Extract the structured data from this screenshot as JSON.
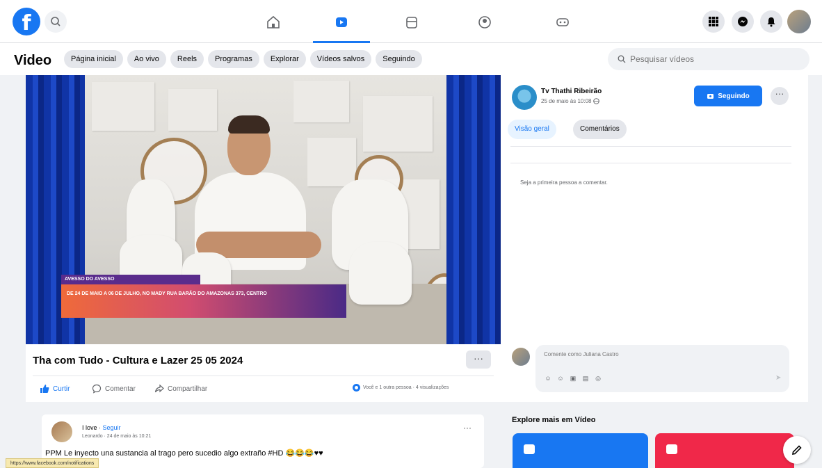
{
  "nav": {
    "logo_letter": "f",
    "tabs": [
      "home-icon",
      "video-icon",
      "marketplace-icon",
      "groups-icon",
      "gaming-icon"
    ],
    "right_icons": [
      "menu-grid-icon",
      "messenger-icon",
      "notifications-icon"
    ],
    "accent": "#1877f2"
  },
  "subheader": {
    "title": "Video",
    "chips": [
      "Página inicial",
      "Ao vivo",
      "Reels",
      "Programas",
      "Explorar",
      "Vídeos salvos",
      "Seguindo"
    ],
    "search_placeholder": "Pesquisar vídeos"
  },
  "video": {
    "banner_top": "AVESSO DO AVESSO",
    "banner_text": "DE 24 DE MAIO A 06 DE JULHO, NO MADY RUA BARÃO DO AMAZONAS 373, CENTRO",
    "title": "Tha com Tudo - Cultura e Lazer 25 05 2024",
    "actions": {
      "like": "Curtir",
      "comment": "Comentar",
      "share": "Compartilhar"
    },
    "views": "Você e 1 outra pessoa · 4 visualizações"
  },
  "side": {
    "page_name": "Tv Thathi Ribeirão",
    "date": "25 de maio às 10:08",
    "follow_label": "Seguindo",
    "tabs": [
      "Visão geral",
      "Comentários"
    ],
    "first_comment": "Seja a primeira pessoa a comentar.",
    "comment_placeholder": "Comente como Juliana Castro"
  },
  "post": {
    "author": "I love",
    "follow": "Seguir",
    "sub": "Leonardo · 24 de maio às 10:21",
    "text": "PPM Le inyecto una sustancia al trago pero sucedio algo extraño #HD 😂😂😂♥♥"
  },
  "status_url": "https://www.facebook.com/notifications",
  "explore": {
    "title": "Explore mais em Vídeo"
  }
}
